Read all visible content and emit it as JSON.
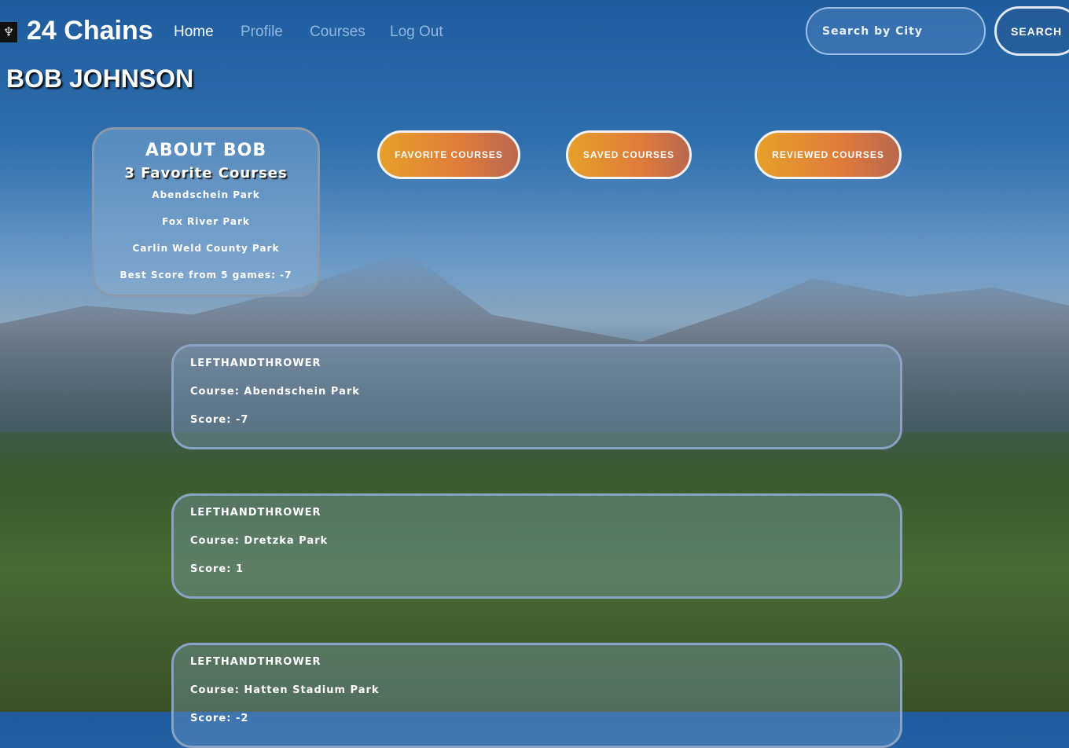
{
  "nav": {
    "brand": "24 Chains",
    "links": [
      "Home",
      "Profile",
      "Courses",
      "Log Out"
    ],
    "search_placeholder": "Search by City",
    "search_button": "SEARCH"
  },
  "page_title": "BOB JOHNSON",
  "about": {
    "heading": "ABOUT BOB",
    "favorites_count": "3 Favorite Courses",
    "courses": [
      "Abendschein Park",
      "Fox River Park",
      "Carlin Weld County Park"
    ],
    "best_score": "Best Score from 5 games: -7"
  },
  "buttons": [
    "FAVORITE COURSES",
    "SAVED COURSES",
    "REVIEWED COURSES"
  ],
  "reviews": [
    {
      "user": "LEFTHANDTHROWER",
      "course": "Course: Abendschein Park",
      "score": "Score: -7"
    },
    {
      "user": "LEFTHANDTHROWER",
      "course": "Course: Dretzka Park",
      "score": "Score: 1"
    },
    {
      "user": "LEFTHANDTHROWER",
      "course": "Course: Hatten Stadium Park",
      "score": "Score: -2"
    }
  ]
}
